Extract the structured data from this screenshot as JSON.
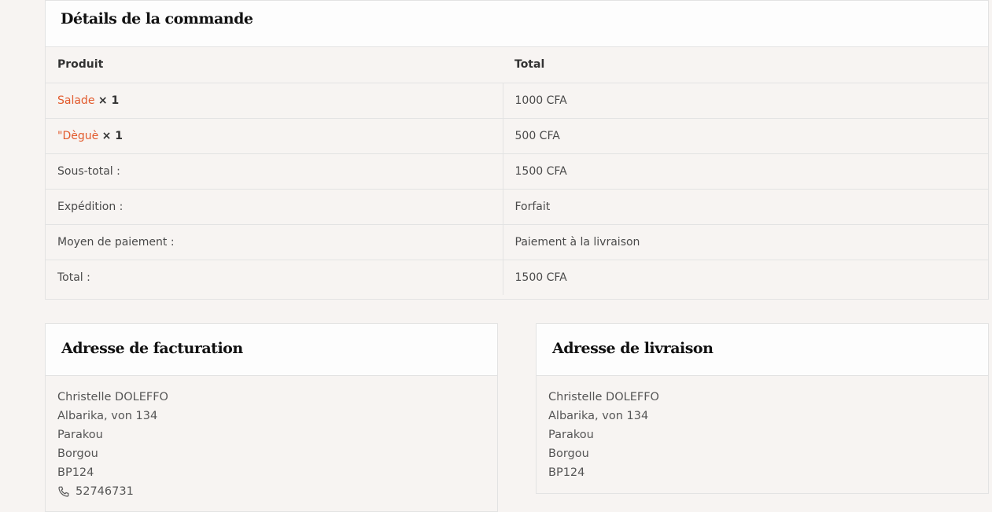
{
  "order": {
    "title": "Détails de la commande",
    "headers": {
      "product": "Produit",
      "total": "Total"
    },
    "items": [
      {
        "name": "Salade",
        "qty": "× 1",
        "total": "1000 CFA"
      },
      {
        "name": "\"Dèguè",
        "qty": "× 1",
        "total": "500 CFA"
      }
    ],
    "summary": [
      {
        "label": "Sous-total :",
        "value": "1500 CFA"
      },
      {
        "label": "Expédition :",
        "value": "Forfait"
      },
      {
        "label": "Moyen de paiement :",
        "value": "Paiement à la livraison"
      },
      {
        "label": "Total :",
        "value": "1500 CFA"
      }
    ]
  },
  "billing": {
    "title": "Adresse de facturation",
    "name": "Christelle DOLEFFO",
    "street": "Albarika, von 134",
    "city": "Parakou",
    "region": "Borgou",
    "postcode": "BP124",
    "phone": "52746731",
    "phone_icon": "phone-icon"
  },
  "shipping": {
    "title": "Adresse de livraison",
    "name": "Christelle DOLEFFO",
    "street": "Albarika, von 134",
    "city": "Parakou",
    "region": "Borgou",
    "postcode": "BP124"
  },
  "colors": {
    "link": "#e25a2c",
    "background": "#f7f4f2",
    "border": "#e3e3e3"
  }
}
